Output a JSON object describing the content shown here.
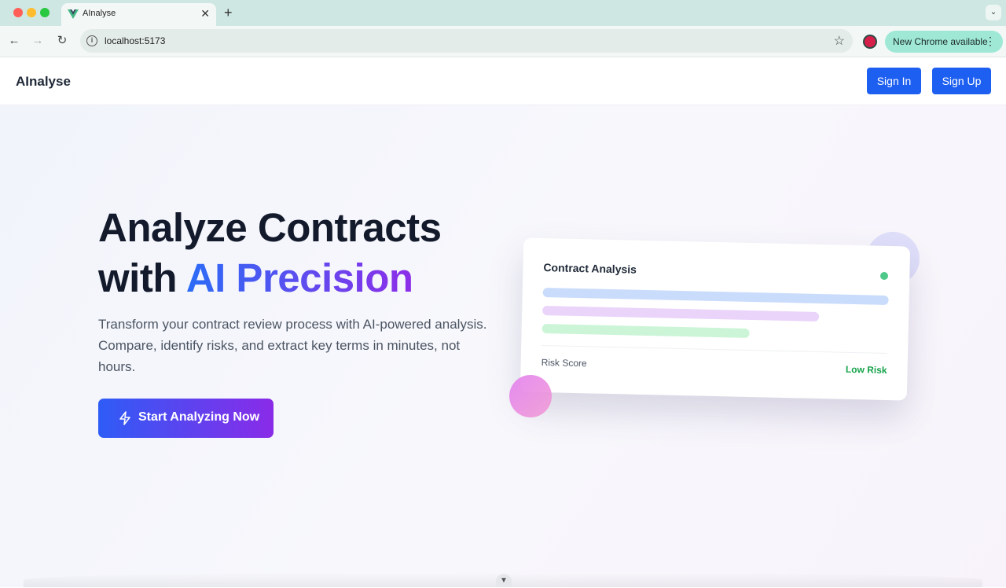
{
  "browser": {
    "tab_title": "AInalyse",
    "url": "localhost:5173",
    "update_pill_label": "New Chrome available"
  },
  "app": {
    "brand": "AInalyse",
    "sign_in_label": "Sign In",
    "sign_up_label": "Sign Up"
  },
  "hero": {
    "headline_line1": "Analyze Contracts",
    "headline_with": "with ",
    "headline_accent": "AI Precision",
    "subtext": "Transform your contract review process with AI-powered analysis. Compare, identify risks, and extract key terms in minutes, not hours.",
    "cta_label": "Start Analyzing Now",
    "cta_icon": "lightning-icon"
  },
  "card": {
    "title": "Contract Analysis",
    "risk_label": "Risk Score",
    "risk_value": "Low Risk"
  },
  "colors": {
    "primary": "#1d5ff0",
    "gradient_start": "#2e5cf6",
    "gradient_end": "#8a2be8",
    "low_risk": "#16a34a"
  }
}
